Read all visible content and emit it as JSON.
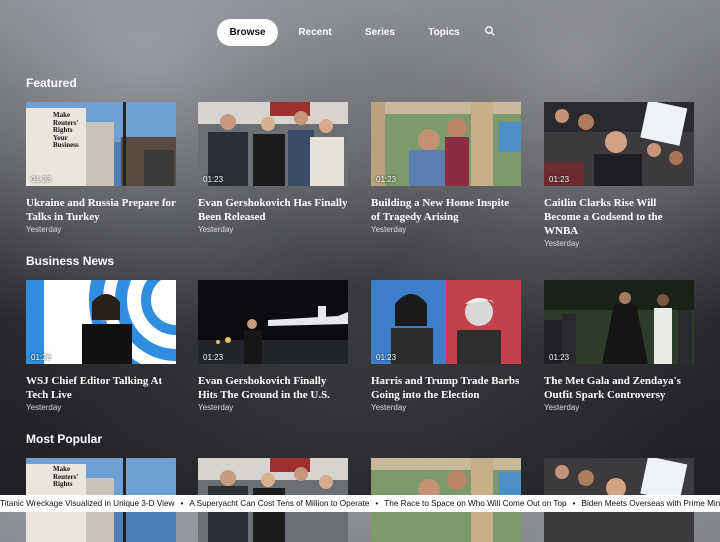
{
  "nav": {
    "tabs": [
      {
        "label": "Browse",
        "active": true
      },
      {
        "label": "Recent",
        "active": false
      },
      {
        "label": "Series",
        "active": false
      },
      {
        "label": "Topics",
        "active": false
      }
    ],
    "search_icon": "search-icon"
  },
  "sections": [
    {
      "title": "Featured",
      "cards": [
        {
          "duration": "01:23",
          "title": "Ukraine and Russia Prepare for Talks in Turkey",
          "time": "Yesterday",
          "thumb_text": "Make Reuters' Rights Your Business"
        },
        {
          "duration": "01:23",
          "title": "Evan Gershokovich Has Finally Been Released",
          "time": "Yesterday"
        },
        {
          "duration": "01:23",
          "title": "Building a New Home Inspite of Tragedy Arising",
          "time": "Yesterday"
        },
        {
          "duration": "01:23",
          "title": "Caitlin Clarks Rise Will Become a Godsend to the WNBA",
          "time": "Yesterday"
        }
      ]
    },
    {
      "title": "Business News",
      "cards": [
        {
          "duration": "01:23",
          "title": "WSJ Chief Editor Talking At Tech Live",
          "time": "Yesterday"
        },
        {
          "duration": "01:23",
          "title": "Evan Gershokovich Finally Hits The Ground in the U.S.",
          "time": "Yesterday"
        },
        {
          "duration": "01:23",
          "title": "Harris and Trump Trade Barbs Going into the Election",
          "time": "Yesterday"
        },
        {
          "duration": "01:23",
          "title": "The Met Gala and Zendaya's Outfit Spark Controversy",
          "time": "Yesterday"
        }
      ]
    },
    {
      "title": "Most Popular",
      "cards": [
        {
          "thumb_text": "Make Reuters' Rights"
        },
        {},
        {},
        {}
      ]
    }
  ],
  "ticker": [
    "Titanic Wreckage Visualized in Unique 3-D View",
    "A Superyacht Can Cost Tens of Million to Operate",
    "The Race to Space on Who Will Come Out on Top",
    "Biden Meets Overseas with Prime Minister"
  ],
  "ticker_separator": "•"
}
